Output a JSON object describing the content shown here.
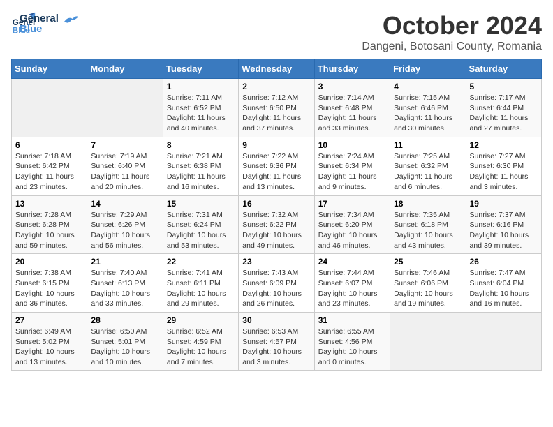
{
  "header": {
    "logo_general": "General",
    "logo_blue": "Blue",
    "title": "October 2024",
    "subtitle": "Dangeni, Botosani County, Romania"
  },
  "calendar": {
    "days_of_week": [
      "Sunday",
      "Monday",
      "Tuesday",
      "Wednesday",
      "Thursday",
      "Friday",
      "Saturday"
    ],
    "weeks": [
      [
        {
          "day": "",
          "details": ""
        },
        {
          "day": "",
          "details": ""
        },
        {
          "day": "1",
          "details": "Sunrise: 7:11 AM\nSunset: 6:52 PM\nDaylight: 11 hours and 40 minutes."
        },
        {
          "day": "2",
          "details": "Sunrise: 7:12 AM\nSunset: 6:50 PM\nDaylight: 11 hours and 37 minutes."
        },
        {
          "day": "3",
          "details": "Sunrise: 7:14 AM\nSunset: 6:48 PM\nDaylight: 11 hours and 33 minutes."
        },
        {
          "day": "4",
          "details": "Sunrise: 7:15 AM\nSunset: 6:46 PM\nDaylight: 11 hours and 30 minutes."
        },
        {
          "day": "5",
          "details": "Sunrise: 7:17 AM\nSunset: 6:44 PM\nDaylight: 11 hours and 27 minutes."
        }
      ],
      [
        {
          "day": "6",
          "details": "Sunrise: 7:18 AM\nSunset: 6:42 PM\nDaylight: 11 hours and 23 minutes."
        },
        {
          "day": "7",
          "details": "Sunrise: 7:19 AM\nSunset: 6:40 PM\nDaylight: 11 hours and 20 minutes."
        },
        {
          "day": "8",
          "details": "Sunrise: 7:21 AM\nSunset: 6:38 PM\nDaylight: 11 hours and 16 minutes."
        },
        {
          "day": "9",
          "details": "Sunrise: 7:22 AM\nSunset: 6:36 PM\nDaylight: 11 hours and 13 minutes."
        },
        {
          "day": "10",
          "details": "Sunrise: 7:24 AM\nSunset: 6:34 PM\nDaylight: 11 hours and 9 minutes."
        },
        {
          "day": "11",
          "details": "Sunrise: 7:25 AM\nSunset: 6:32 PM\nDaylight: 11 hours and 6 minutes."
        },
        {
          "day": "12",
          "details": "Sunrise: 7:27 AM\nSunset: 6:30 PM\nDaylight: 11 hours and 3 minutes."
        }
      ],
      [
        {
          "day": "13",
          "details": "Sunrise: 7:28 AM\nSunset: 6:28 PM\nDaylight: 10 hours and 59 minutes."
        },
        {
          "day": "14",
          "details": "Sunrise: 7:29 AM\nSunset: 6:26 PM\nDaylight: 10 hours and 56 minutes."
        },
        {
          "day": "15",
          "details": "Sunrise: 7:31 AM\nSunset: 6:24 PM\nDaylight: 10 hours and 53 minutes."
        },
        {
          "day": "16",
          "details": "Sunrise: 7:32 AM\nSunset: 6:22 PM\nDaylight: 10 hours and 49 minutes."
        },
        {
          "day": "17",
          "details": "Sunrise: 7:34 AM\nSunset: 6:20 PM\nDaylight: 10 hours and 46 minutes."
        },
        {
          "day": "18",
          "details": "Sunrise: 7:35 AM\nSunset: 6:18 PM\nDaylight: 10 hours and 43 minutes."
        },
        {
          "day": "19",
          "details": "Sunrise: 7:37 AM\nSunset: 6:16 PM\nDaylight: 10 hours and 39 minutes."
        }
      ],
      [
        {
          "day": "20",
          "details": "Sunrise: 7:38 AM\nSunset: 6:15 PM\nDaylight: 10 hours and 36 minutes."
        },
        {
          "day": "21",
          "details": "Sunrise: 7:40 AM\nSunset: 6:13 PM\nDaylight: 10 hours and 33 minutes."
        },
        {
          "day": "22",
          "details": "Sunrise: 7:41 AM\nSunset: 6:11 PM\nDaylight: 10 hours and 29 minutes."
        },
        {
          "day": "23",
          "details": "Sunrise: 7:43 AM\nSunset: 6:09 PM\nDaylight: 10 hours and 26 minutes."
        },
        {
          "day": "24",
          "details": "Sunrise: 7:44 AM\nSunset: 6:07 PM\nDaylight: 10 hours and 23 minutes."
        },
        {
          "day": "25",
          "details": "Sunrise: 7:46 AM\nSunset: 6:06 PM\nDaylight: 10 hours and 19 minutes."
        },
        {
          "day": "26",
          "details": "Sunrise: 7:47 AM\nSunset: 6:04 PM\nDaylight: 10 hours and 16 minutes."
        }
      ],
      [
        {
          "day": "27",
          "details": "Sunrise: 6:49 AM\nSunset: 5:02 PM\nDaylight: 10 hours and 13 minutes."
        },
        {
          "day": "28",
          "details": "Sunrise: 6:50 AM\nSunset: 5:01 PM\nDaylight: 10 hours and 10 minutes."
        },
        {
          "day": "29",
          "details": "Sunrise: 6:52 AM\nSunset: 4:59 PM\nDaylight: 10 hours and 7 minutes."
        },
        {
          "day": "30",
          "details": "Sunrise: 6:53 AM\nSunset: 4:57 PM\nDaylight: 10 hours and 3 minutes."
        },
        {
          "day": "31",
          "details": "Sunrise: 6:55 AM\nSunset: 4:56 PM\nDaylight: 10 hours and 0 minutes."
        },
        {
          "day": "",
          "details": ""
        },
        {
          "day": "",
          "details": ""
        }
      ]
    ]
  }
}
